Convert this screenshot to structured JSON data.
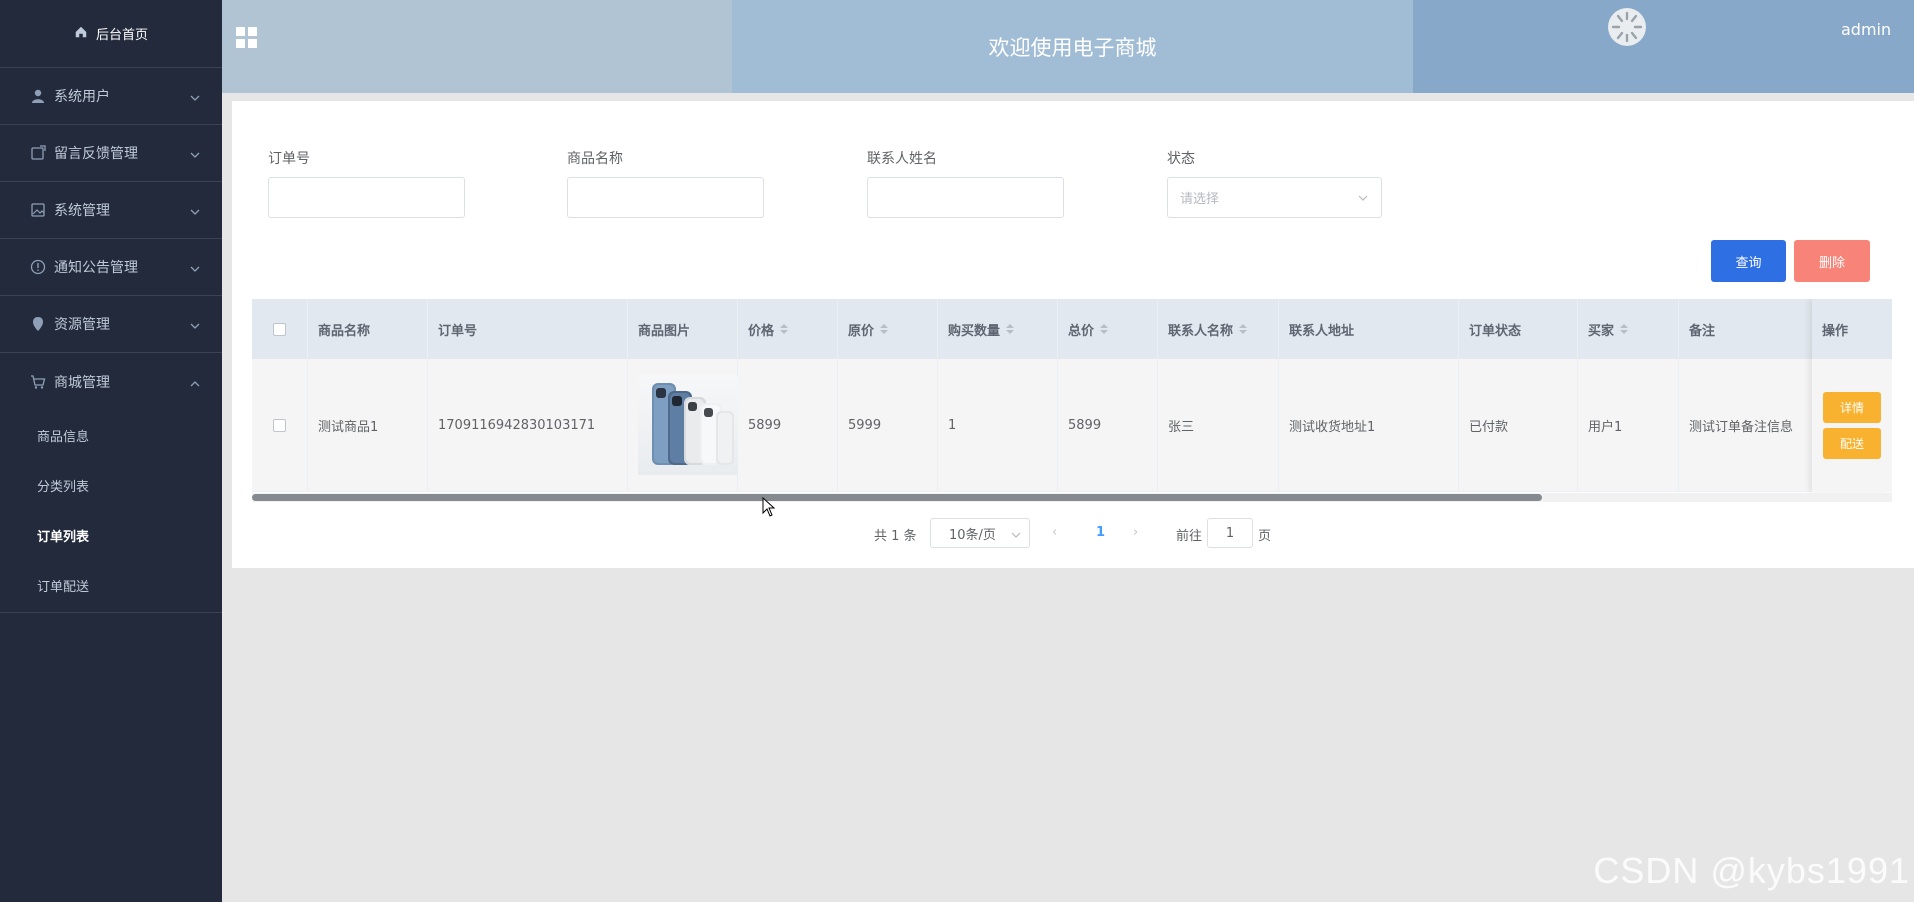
{
  "sidebar": {
    "home_label": "后台首页",
    "items": [
      {
        "label": "系统用户",
        "icon": "user-icon"
      },
      {
        "label": "留言反馈管理",
        "icon": "feedback-icon"
      },
      {
        "label": "系统管理",
        "icon": "image-icon"
      },
      {
        "label": "通知公告管理",
        "icon": "info-icon"
      },
      {
        "label": "资源管理",
        "icon": "location-icon"
      },
      {
        "label": "商城管理",
        "icon": "cart-icon"
      }
    ],
    "sub_items": [
      "商品信息",
      "分类列表",
      "订单列表",
      "订单配送"
    ],
    "active_sub": "订单列表"
  },
  "header": {
    "title": "欢迎使用电子商城",
    "username": "admin"
  },
  "filters": {
    "order_no_label": "订单号",
    "product_name_label": "商品名称",
    "contact_name_label": "联系人姓名",
    "status_label": "状态",
    "status_placeholder": "请选择",
    "query_button": "查询",
    "delete_button": "删除"
  },
  "table": {
    "columns": [
      "商品名称",
      "订单号",
      "商品图片",
      "价格",
      "原价",
      "购买数量",
      "总价",
      "联系人名称",
      "联系人地址",
      "订单状态",
      "买家",
      "备注",
      "操作"
    ],
    "rows": [
      {
        "product_name": "测试商品1",
        "order_no": "1709116942830103171",
        "price": "5899",
        "original_price": "5999",
        "quantity": "1",
        "total": "5899",
        "contact_name": "张三",
        "contact_address": "测试收货地址1",
        "status": "已付款",
        "buyer": "用户1",
        "remark": "测试订单备注信息",
        "detail_button": "详情",
        "ship_button": "配送"
      }
    ]
  },
  "pagination": {
    "total": "共 1 条",
    "page_size": "10条/页",
    "current_page": "1",
    "goto_label": "前往",
    "goto_value": "1",
    "page_suffix": "页"
  },
  "watermark": "CSDN @kybs1991",
  "colors": {
    "sidebar_bg": "#232a3b",
    "primary": "#2f6fe4",
    "danger": "#f78379",
    "warning": "#f8b22f"
  }
}
